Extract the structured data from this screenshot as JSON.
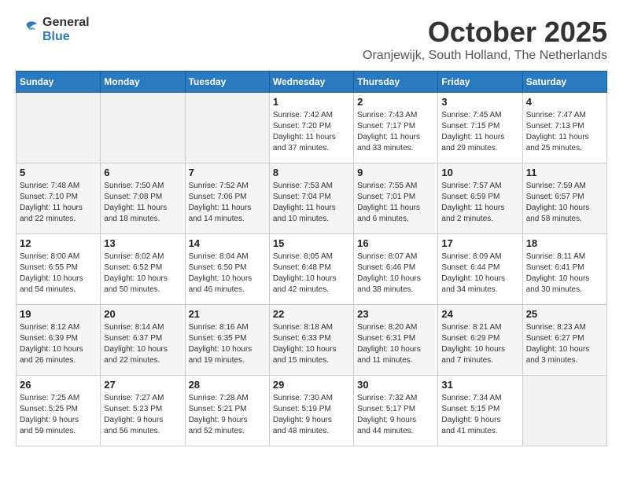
{
  "header": {
    "logo_line1": "General",
    "logo_line2": "Blue",
    "month": "October 2025",
    "location": "Oranjewijk, South Holland, The Netherlands"
  },
  "weekdays": [
    "Sunday",
    "Monday",
    "Tuesday",
    "Wednesday",
    "Thursday",
    "Friday",
    "Saturday"
  ],
  "weeks": [
    [
      {
        "day": "",
        "info": ""
      },
      {
        "day": "",
        "info": ""
      },
      {
        "day": "",
        "info": ""
      },
      {
        "day": "1",
        "info": "Sunrise: 7:42 AM\nSunset: 7:20 PM\nDaylight: 11 hours\nand 37 minutes."
      },
      {
        "day": "2",
        "info": "Sunrise: 7:43 AM\nSunset: 7:17 PM\nDaylight: 11 hours\nand 33 minutes."
      },
      {
        "day": "3",
        "info": "Sunrise: 7:45 AM\nSunset: 7:15 PM\nDaylight: 11 hours\nand 29 minutes."
      },
      {
        "day": "4",
        "info": "Sunrise: 7:47 AM\nSunset: 7:13 PM\nDaylight: 11 hours\nand 25 minutes."
      }
    ],
    [
      {
        "day": "5",
        "info": "Sunrise: 7:48 AM\nSunset: 7:10 PM\nDaylight: 11 hours\nand 22 minutes."
      },
      {
        "day": "6",
        "info": "Sunrise: 7:50 AM\nSunset: 7:08 PM\nDaylight: 11 hours\nand 18 minutes."
      },
      {
        "day": "7",
        "info": "Sunrise: 7:52 AM\nSunset: 7:06 PM\nDaylight: 11 hours\nand 14 minutes."
      },
      {
        "day": "8",
        "info": "Sunrise: 7:53 AM\nSunset: 7:04 PM\nDaylight: 11 hours\nand 10 minutes."
      },
      {
        "day": "9",
        "info": "Sunrise: 7:55 AM\nSunset: 7:01 PM\nDaylight: 11 hours\nand 6 minutes."
      },
      {
        "day": "10",
        "info": "Sunrise: 7:57 AM\nSunset: 6:59 PM\nDaylight: 11 hours\nand 2 minutes."
      },
      {
        "day": "11",
        "info": "Sunrise: 7:59 AM\nSunset: 6:57 PM\nDaylight: 10 hours\nand 58 minutes."
      }
    ],
    [
      {
        "day": "12",
        "info": "Sunrise: 8:00 AM\nSunset: 6:55 PM\nDaylight: 10 hours\nand 54 minutes."
      },
      {
        "day": "13",
        "info": "Sunrise: 8:02 AM\nSunset: 6:52 PM\nDaylight: 10 hours\nand 50 minutes."
      },
      {
        "day": "14",
        "info": "Sunrise: 8:04 AM\nSunset: 6:50 PM\nDaylight: 10 hours\nand 46 minutes."
      },
      {
        "day": "15",
        "info": "Sunrise: 8:05 AM\nSunset: 6:48 PM\nDaylight: 10 hours\nand 42 minutes."
      },
      {
        "day": "16",
        "info": "Sunrise: 8:07 AM\nSunset: 6:46 PM\nDaylight: 10 hours\nand 38 minutes."
      },
      {
        "day": "17",
        "info": "Sunrise: 8:09 AM\nSunset: 6:44 PM\nDaylight: 10 hours\nand 34 minutes."
      },
      {
        "day": "18",
        "info": "Sunrise: 8:11 AM\nSunset: 6:41 PM\nDaylight: 10 hours\nand 30 minutes."
      }
    ],
    [
      {
        "day": "19",
        "info": "Sunrise: 8:12 AM\nSunset: 6:39 PM\nDaylight: 10 hours\nand 26 minutes."
      },
      {
        "day": "20",
        "info": "Sunrise: 8:14 AM\nSunset: 6:37 PM\nDaylight: 10 hours\nand 22 minutes."
      },
      {
        "day": "21",
        "info": "Sunrise: 8:16 AM\nSunset: 6:35 PM\nDaylight: 10 hours\nand 19 minutes."
      },
      {
        "day": "22",
        "info": "Sunrise: 8:18 AM\nSunset: 6:33 PM\nDaylight: 10 hours\nand 15 minutes."
      },
      {
        "day": "23",
        "info": "Sunrise: 8:20 AM\nSunset: 6:31 PM\nDaylight: 10 hours\nand 11 minutes."
      },
      {
        "day": "24",
        "info": "Sunrise: 8:21 AM\nSunset: 6:29 PM\nDaylight: 10 hours\nand 7 minutes."
      },
      {
        "day": "25",
        "info": "Sunrise: 8:23 AM\nSunset: 6:27 PM\nDaylight: 10 hours\nand 3 minutes."
      }
    ],
    [
      {
        "day": "26",
        "info": "Sunrise: 7:25 AM\nSunset: 5:25 PM\nDaylight: 9 hours\nand 59 minutes."
      },
      {
        "day": "27",
        "info": "Sunrise: 7:27 AM\nSunset: 5:23 PM\nDaylight: 9 hours\nand 56 minutes."
      },
      {
        "day": "28",
        "info": "Sunrise: 7:28 AM\nSunset: 5:21 PM\nDaylight: 9 hours\nand 52 minutes."
      },
      {
        "day": "29",
        "info": "Sunrise: 7:30 AM\nSunset: 5:19 PM\nDaylight: 9 hours\nand 48 minutes."
      },
      {
        "day": "30",
        "info": "Sunrise: 7:32 AM\nSunset: 5:17 PM\nDaylight: 9 hours\nand 44 minutes."
      },
      {
        "day": "31",
        "info": "Sunrise: 7:34 AM\nSunset: 5:15 PM\nDaylight: 9 hours\nand 41 minutes."
      },
      {
        "day": "",
        "info": ""
      }
    ]
  ]
}
